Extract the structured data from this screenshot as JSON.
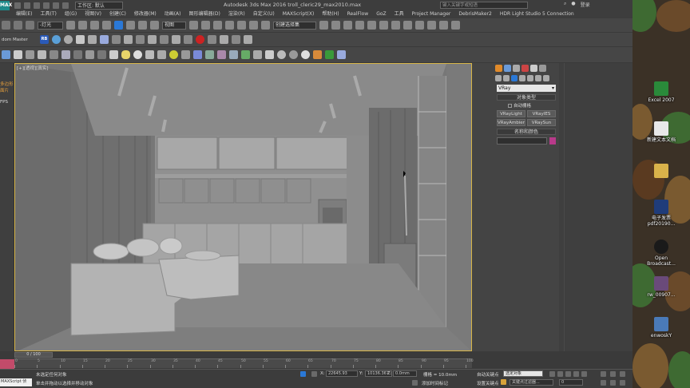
{
  "app": {
    "logo": "MAX",
    "workspace_label": "工作区: 默认",
    "title": "Autodesk 3ds Max 2016   troll_cleric29_max2010.max",
    "search_placeholder": "键入关键字或短语",
    "login": "登录"
  },
  "menu": [
    "编辑(E)",
    "工具(T)",
    "组(G)",
    "视图(V)",
    "创建(C)",
    "修改器(M)",
    "动画(A)",
    "图形编辑器(D)",
    "渲染(R)",
    "自定义(U)",
    "MAXScript(X)",
    "帮助(H)",
    "RealFlow",
    "GoZ",
    "工具",
    "Project Manager",
    "DebrisMaker2",
    "HDR Light Studio 5 Connection"
  ],
  "toolbar1": {
    "selection_filter": "-灯光",
    "view_dropdown": "视图",
    "named_selection": "创建选择集"
  },
  "toolbar2": {
    "label": "dom Master",
    "rb_label": "RB"
  },
  "left_strip": {
    "mode1": "多边形",
    "mode2": "面片",
    "fps_label": "FPS"
  },
  "viewport": {
    "label": "[+][透视][真实]"
  },
  "command_panel": {
    "category": "VRay",
    "object_type_header": "对象类型",
    "auto_grid": "自动栅格",
    "objects": [
      "VRayLight",
      "VRayIES",
      "VRayAmbientLigh",
      "VRaySun"
    ],
    "name_color_header": "名称和颜色"
  },
  "timeline": {
    "frame_label": "0 / 100",
    "ticks": [
      "0",
      "5",
      "10",
      "15",
      "20",
      "25",
      "30",
      "35",
      "40",
      "45",
      "50",
      "55",
      "60",
      "65",
      "70",
      "75",
      "80",
      "85",
      "90",
      "95",
      "100"
    ]
  },
  "status": {
    "maxscript": "MAXScript 侦",
    "msg1": "未选定任何对象",
    "msg2": "单击并拖动以选择并移动对象",
    "x_label": "X:",
    "x_value": "22645.93",
    "y_label": "Y:",
    "y_value": "10136.367",
    "z_label": "Z:",
    "z_value": "0.0mm",
    "grid": "栅格 = 10.0mm",
    "add_time_tag": "添加时间标记",
    "autokey": "自动关键点",
    "set_key": "设置关键点",
    "selected_object": "选定对象",
    "key_filter": "关键点过滤器...",
    "frame_spinner": "0"
  },
  "desktop_icons": [
    {
      "name": "excel-icon",
      "label": "Excel 2007",
      "color": "#2a8a3a"
    },
    {
      "name": "text-doc-icon",
      "label": "新建文本文档",
      "color": "#e8e8e8"
    },
    {
      "name": "folder-icon",
      "label": "",
      "color": "#d9b24a"
    },
    {
      "name": "photoshop-icon",
      "label": "电子发票\npdf20190...",
      "color": "#1f3c7a"
    },
    {
      "name": "obs-icon",
      "label": "Open\nBroadcast...",
      "color": "#1a1a1a"
    },
    {
      "name": "image-file-icon",
      "label": "rw_00907...",
      "color": "#6a4a7a"
    },
    {
      "name": "sky-file-icon",
      "label": "enwoskY",
      "color": "#4a7ab8"
    }
  ],
  "colors": {
    "viewport_border": "#d8b648",
    "accent_blue": "#2a78d6",
    "timeline_key": "#c24b6a",
    "swatch": "#b83a8a"
  }
}
